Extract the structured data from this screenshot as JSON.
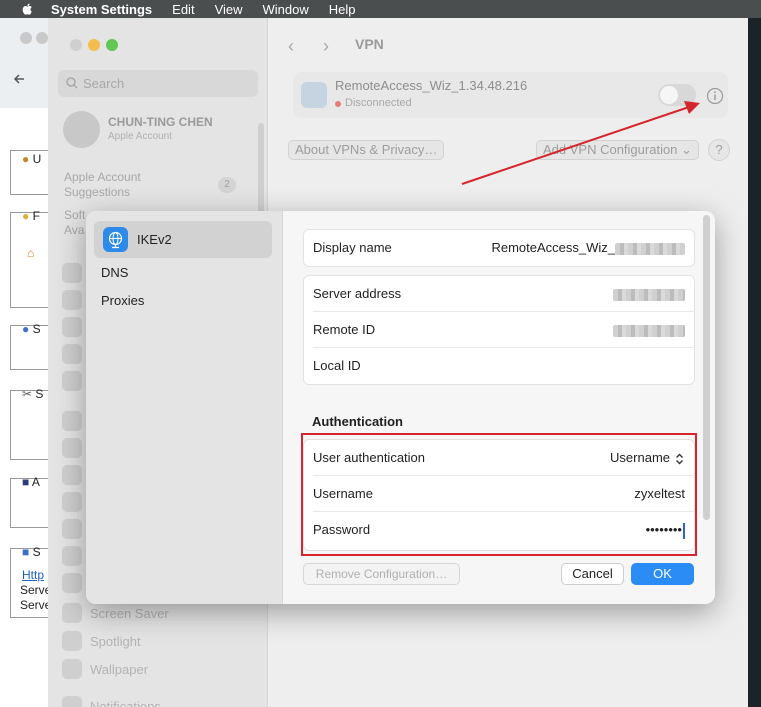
{
  "menubar": {
    "app": "System Settings",
    "items": [
      "Edit",
      "View",
      "Window",
      "Help"
    ]
  },
  "sidebar": {
    "search_placeholder": "Search",
    "account_name": "CHUN-TING CHEN",
    "account_sub": "Apple Account",
    "suggestions_line1": "Apple Account",
    "suggestions_line2": "Suggestions",
    "suggestions_badge": "2",
    "partial_line1": "Soft",
    "partial_line2": "Ava",
    "items": [
      {
        "label": "Screen Saver"
      },
      {
        "label": "Spotlight"
      },
      {
        "label": "Wallpaper"
      },
      {
        "label": "Notifications"
      }
    ]
  },
  "content": {
    "title": "VPN",
    "vpn_name": "RemoteAccess_Wiz_1.34.48.216",
    "vpn_status": "Disconnected",
    "about_button": "About VPNs & Privacy…",
    "add_button": "Add VPN Configuration",
    "help": "?"
  },
  "dialog": {
    "side_items": [
      {
        "label": "IKEv2"
      },
      {
        "label": "DNS"
      },
      {
        "label": "Proxies"
      }
    ],
    "display_name_label": "Display name",
    "display_name_value": "RemoteAccess_Wiz_",
    "server_address_label": "Server address",
    "remote_id_label": "Remote ID",
    "local_id_label": "Local ID",
    "auth_section": "Authentication",
    "user_auth_label": "User authentication",
    "user_auth_value": "Username",
    "username_label": "Username",
    "username_value": "zyxeltest",
    "password_label": "Password",
    "password_value": "••••••••",
    "remove_button": "Remove Configuration…",
    "cancel_button": "Cancel",
    "ok_button": "OK"
  },
  "bg_window": {
    "labels": [
      "U",
      "F",
      "S",
      "S",
      "A",
      "S"
    ],
    "link_text": "Http",
    "lines": [
      "Serve",
      "Serve"
    ]
  },
  "colors": {
    "accent": "#2b8cf5",
    "annotation_red": "#d5262d",
    "status_red": "#e67b7b"
  }
}
